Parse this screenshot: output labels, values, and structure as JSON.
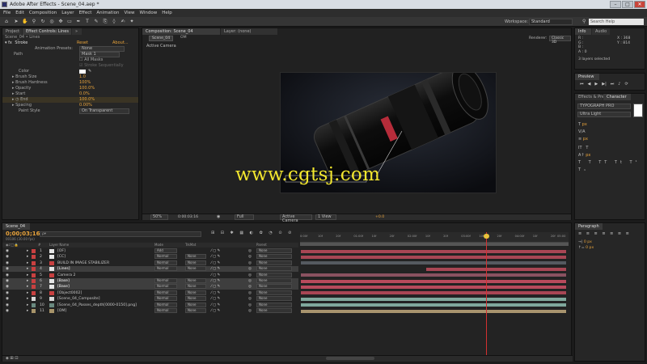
{
  "app": {
    "title": "Adobe After Effects - Scene_04.aep *",
    "menu": [
      "File",
      "Edit",
      "Composition",
      "Layer",
      "Effect",
      "Animation",
      "View",
      "Window",
      "Help"
    ],
    "workspace_label": "Workspace:",
    "workspace_value": "Standard",
    "search_placeholder": "Search Help"
  },
  "left_panel": {
    "tabs": [
      "Project",
      "Effect Controls: Lines",
      "»"
    ],
    "subtitle": "Scene_04 • Lines",
    "effect_name": "Stroke",
    "reset": "Reset",
    "about": "About...",
    "anim_presets_label": "Animation Presets:",
    "anim_presets_value": "None",
    "path_label": "Path",
    "path_value": "Mask 1",
    "all_masks": "All Masks",
    "stroke_seq": "Stroke Sequentially",
    "props": [
      {
        "name": "Color",
        "value": ""
      },
      {
        "name": "Brush Size",
        "value": "1.0"
      },
      {
        "name": "Brush Hardness",
        "value": "100%"
      },
      {
        "name": "Opacity",
        "value": "100.0%"
      },
      {
        "name": "Start",
        "value": "0.0%"
      },
      {
        "name": "End",
        "value": "100.0%"
      },
      {
        "name": "Spacing",
        "value": "0.00%"
      },
      {
        "name": "Paint Style",
        "value": "On Transparent"
      }
    ]
  },
  "comp_panel": {
    "tabs": [
      "Composition: Scene_04",
      "Layer: (none)"
    ],
    "subtabs": [
      "Scene_04",
      "OM"
    ],
    "renderer_label": "Renderer:",
    "renderer_value": "Classic 3D",
    "active_camera": "Active Camera",
    "watermark": "www.cgtsj.com",
    "footer": {
      "zoom": "50%",
      "timecode": "0:00:03:16",
      "quality": "Full",
      "camera": "Active Camera",
      "views": "1 View",
      "exposure": "+0.0"
    }
  },
  "right_panels": {
    "info_tab": "Info",
    "audio_tab": "Audio",
    "info_r": "R :",
    "info_g": "G :",
    "info_b": "B :",
    "info_a": "A : 0",
    "info_x": "X : 368",
    "info_y": "Y : 814",
    "selected": "3 layers selected",
    "preview_tab": "Preview",
    "fx_tab": "Effects & Presets",
    "char_tab": "Character",
    "font": "TYPOGRAPH PRO",
    "font_style": "Ultra Light",
    "px": "px",
    "paragraph_tab": "Paragraph",
    "para_px": "0 px"
  },
  "timeline": {
    "tab": "Scene_04",
    "timecode": "0;00;03;16",
    "frames": "00106 (30.00 fps)",
    "search_placeholder": "ρ▾",
    "headers": {
      "label": "#",
      "name": "Layer Name",
      "mode": "Mode",
      "trkmat": "TrkMat",
      "parent": "Parent"
    },
    "ruler": [
      "0:00f",
      "10f",
      "20f",
      "01:00f",
      "10f",
      "20f",
      "02:00f",
      "10f",
      "20f",
      "03:00f",
      "10f",
      "20f",
      "04:00f",
      "10f",
      "20f",
      "05:00"
    ],
    "layers": [
      {
        "num": "1",
        "name": "[OF]",
        "mode": "Add",
        "trkmat": "",
        "parent": "None",
        "color": "#e6e6e6",
        "selected": false
      },
      {
        "num": "2",
        "name": "[CC]",
        "mode": "Normal",
        "trkmat": "None",
        "parent": "None",
        "color": "#e6e6e6",
        "selected": false
      },
      {
        "num": "3",
        "name": "BUILD IN IMAGE STABILIZER",
        "mode": "Normal",
        "trkmat": "None",
        "parent": "None",
        "color": "#c84040",
        "selected": false
      },
      {
        "num": "4",
        "name": "[Lines]",
        "mode": "Normal",
        "trkmat": "None",
        "parent": "None",
        "color": "#e6e6e6",
        "selected": true
      },
      {
        "num": "5",
        "name": "Camera 2",
        "mode": "",
        "trkmat": "",
        "parent": "None",
        "color": "#c84040",
        "selected": false
      },
      {
        "num": "6",
        "name": "[Base]",
        "mode": "Normal",
        "trkmat": "None",
        "parent": "None",
        "color": "#e6e6e6",
        "selected": true
      },
      {
        "num": "7",
        "name": "[Base]",
        "mode": "Normal",
        "trkmat": "None",
        "parent": "None",
        "color": "#e6e6e6",
        "selected": true
      },
      {
        "num": "8",
        "name": "[Object0002]",
        "mode": "Normal",
        "trkmat": "None",
        "parent": "None",
        "color": "#c84040",
        "selected": false
      },
      {
        "num": "9",
        "name": "[Scene_04_Composite]",
        "mode": "Normal",
        "trkmat": "None",
        "parent": "None",
        "color": "#d8d8d8",
        "selected": false
      },
      {
        "num": "10",
        "name": "[Scene_04_Passes_depth[0000-0150].png]",
        "mode": "Normal",
        "trkmat": "None",
        "parent": "None",
        "color": "#6a8a80",
        "selected": false
      },
      {
        "num": "11",
        "name": "[OM]",
        "mode": "Normal",
        "trkmat": "None",
        "parent": "None",
        "color": "#a8946a",
        "selected": false
      }
    ]
  },
  "colors": {
    "accent_orange": "#e8a33b",
    "playhead": "#d33030",
    "bar_red": "#a84654",
    "bar_teal": "#7fa89c",
    "bar_tan": "#a8946e",
    "watermark": "#f2e62e"
  }
}
